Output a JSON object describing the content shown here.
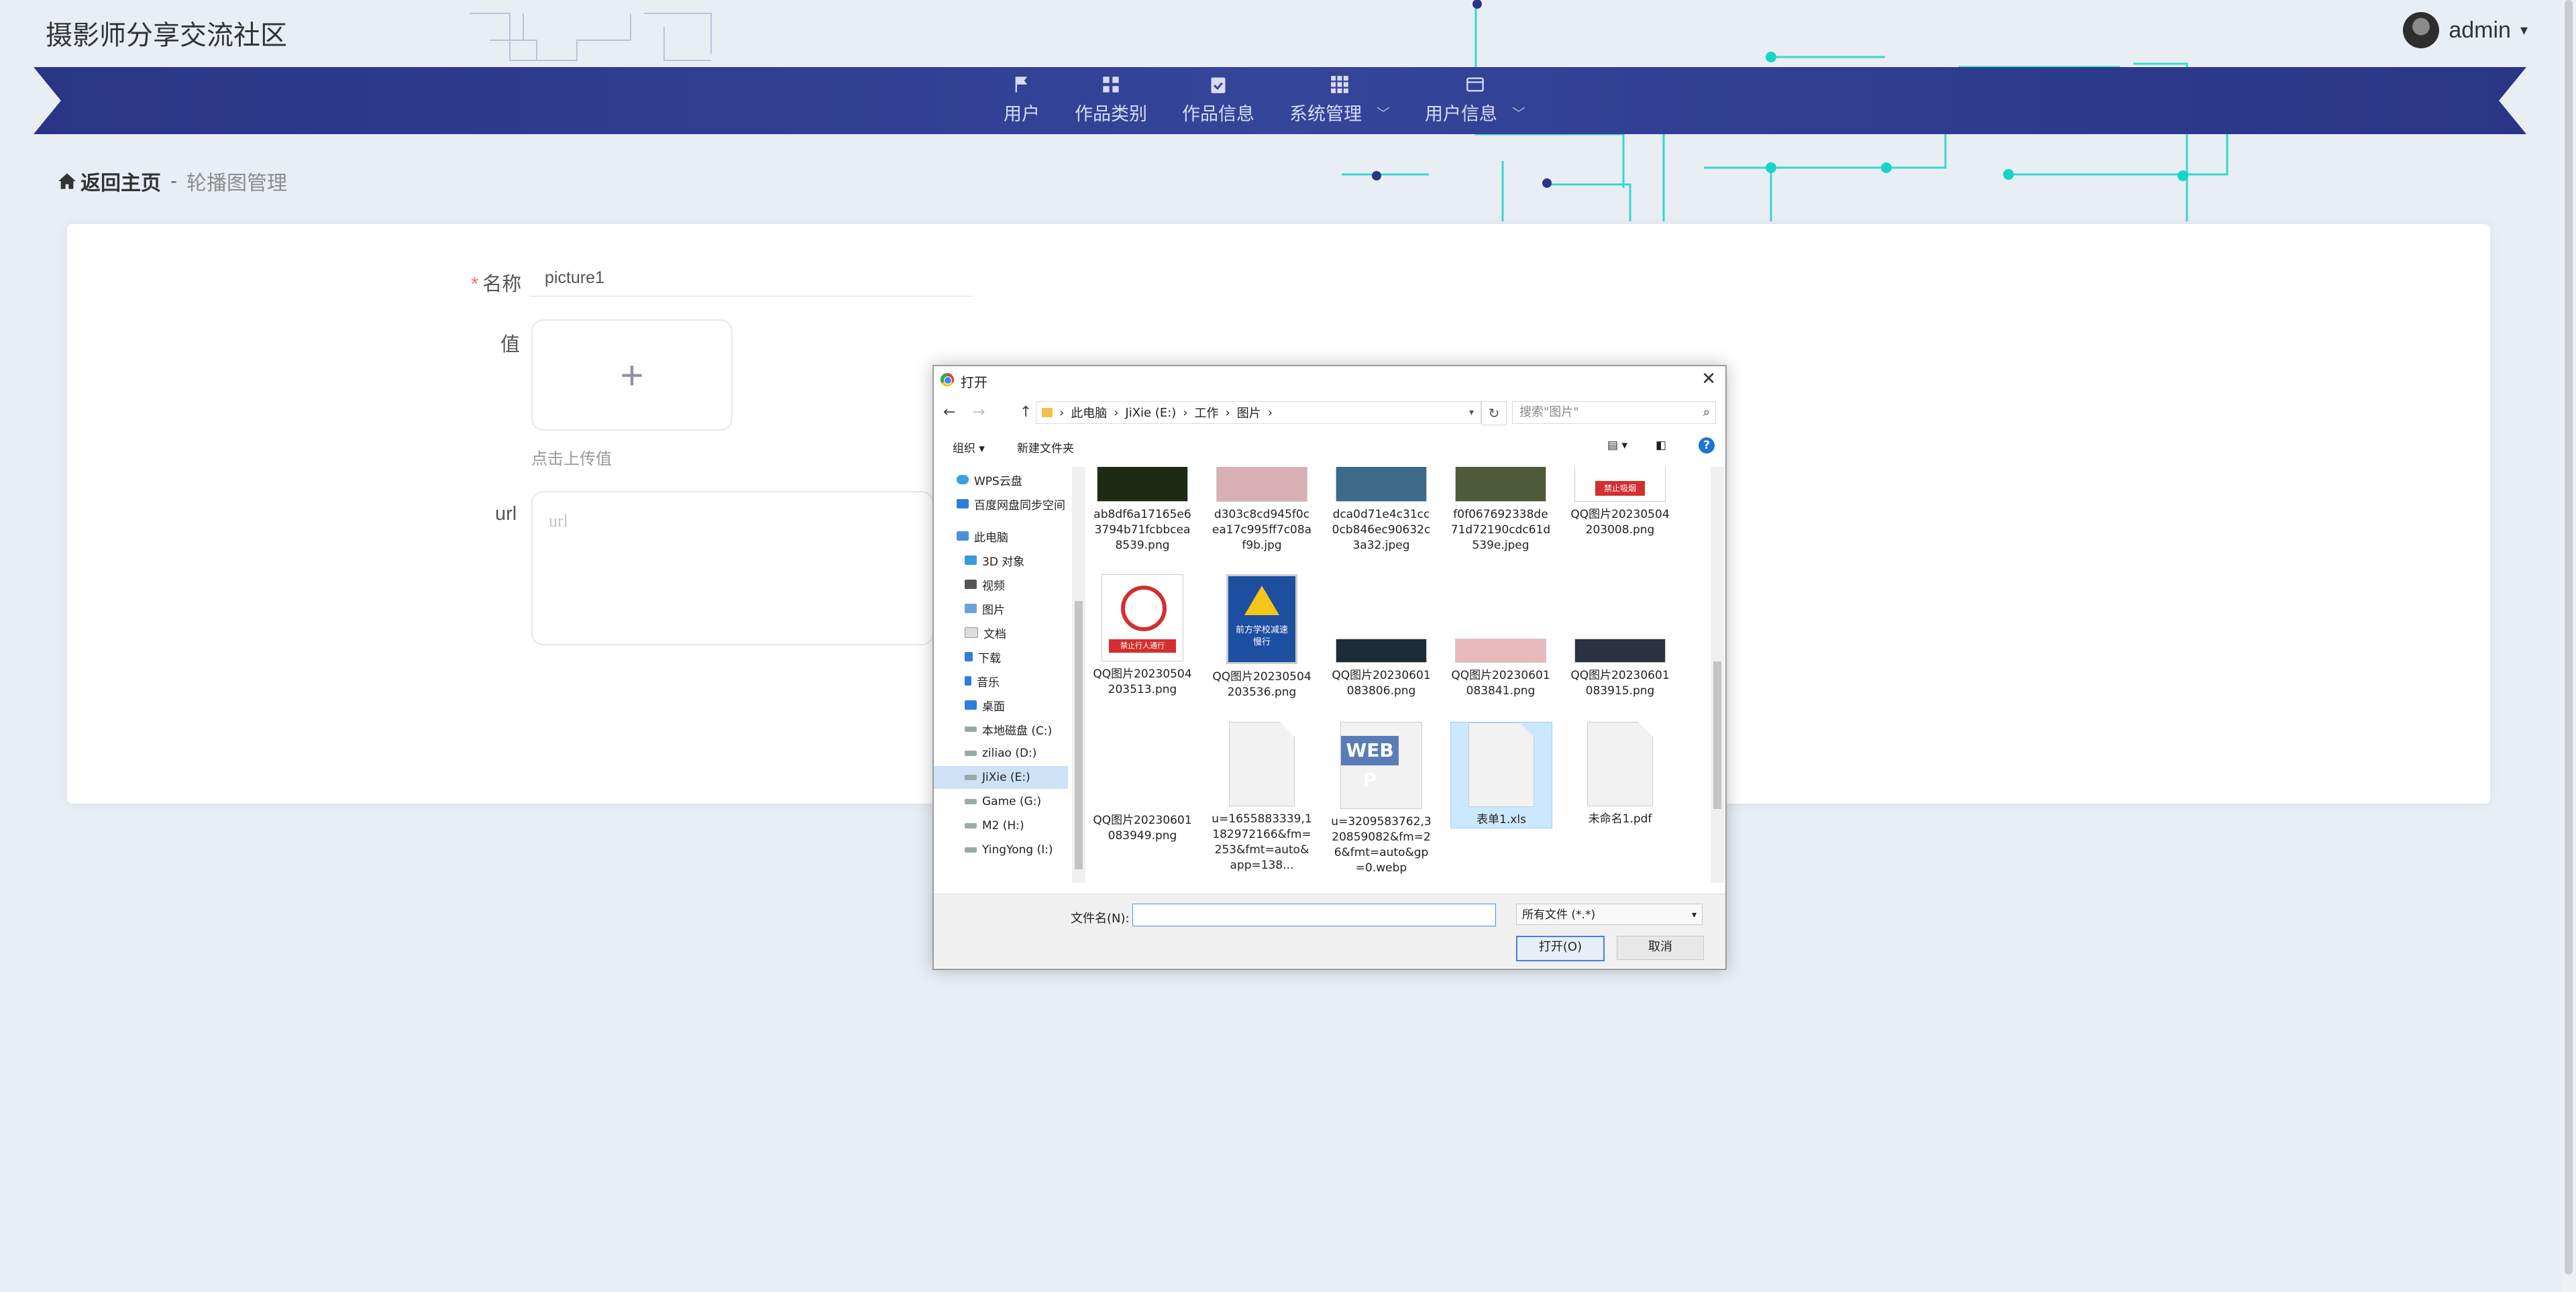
{
  "site": {
    "title": "摄影师分享交流社区"
  },
  "user": {
    "name": "admin",
    "caret": "▾"
  },
  "nav": {
    "items": [
      {
        "label": "用户",
        "icon": "flag-icon"
      },
      {
        "label": "作品类别",
        "icon": "grid-icon"
      },
      {
        "label": "作品信息",
        "icon": "clipboard-check-icon"
      },
      {
        "label": "系统管理",
        "icon": "apps-icon",
        "chevron": "﹀"
      },
      {
        "label": "用户信息",
        "icon": "card-icon",
        "chevron": "﹀"
      }
    ]
  },
  "breadcrumb": {
    "home": "返回主页",
    "separator": "-",
    "current": "轮播图管理"
  },
  "form": {
    "name_label": "名称",
    "name_value": "picture1",
    "required_mark": "*",
    "value_label": "值",
    "upload_plus": "+",
    "upload_hint": "点击上传值",
    "url_label": "url",
    "url_placeholder": "url"
  },
  "dialog": {
    "title": "打开",
    "close": "✕",
    "back": "←",
    "forward": "→",
    "up": "↑",
    "path": [
      "此电脑",
      "JiXie (E:)",
      "工作",
      "图片"
    ],
    "path_sep": "›",
    "refresh": "↻",
    "search_placeholder": "搜索\"图片\"",
    "toolbar": {
      "organize": "组织 ▾",
      "new_folder": "新建文件夹",
      "help": "?"
    },
    "nav_pane": [
      {
        "label": "WPS云盘",
        "icon": "cloud-icon"
      },
      {
        "label": "百度网盘同步空间",
        "icon": "baidu-disk-icon"
      },
      {
        "label": "此电脑",
        "icon": "pc-icon"
      },
      {
        "label": "3D 对象",
        "icon": "cube-icon"
      },
      {
        "label": "视频",
        "icon": "video-icon"
      },
      {
        "label": "图片",
        "icon": "pictures-icon"
      },
      {
        "label": "文档",
        "icon": "documents-icon"
      },
      {
        "label": "下载",
        "icon": "download-icon"
      },
      {
        "label": "音乐",
        "icon": "music-icon"
      },
      {
        "label": "桌面",
        "icon": "desktop-icon"
      },
      {
        "label": "本地磁盘 (C:)",
        "icon": "drive-icon"
      },
      {
        "label": "ziliao (D:)",
        "icon": "drive-icon"
      },
      {
        "label": "JiXie (E:)",
        "icon": "drive-icon"
      },
      {
        "label": "Game (G:)",
        "icon": "drive-icon"
      },
      {
        "label": "M2 (H:)",
        "icon": "drive-icon"
      },
      {
        "label": "YingYong (I:)",
        "icon": "drive-icon"
      }
    ],
    "files": [
      {
        "name": "ab8df6a17165e63794b71fcbbcea8539.png",
        "kind": "photo",
        "color": "#1d2a14"
      },
      {
        "name": "d303c8cd945f0cea17c995ff7c08af9b.jpg",
        "kind": "photo",
        "color": "#d9b0b6"
      },
      {
        "name": "dca0d71e4c31cc0cb846ec90632c3a32.jpeg",
        "kind": "photo",
        "color": "#3c6b8a"
      },
      {
        "name": "f0f067692338de71d72190cdc61d539e.jpeg",
        "kind": "photo",
        "color": "#4e5a3a"
      },
      {
        "name": "QQ图片20230504203008.png",
        "kind": "sign-red",
        "color": "#d32f2f",
        "sign_text": "禁止吸烟"
      },
      {
        "name": "QQ图片20230504203513.png",
        "kind": "sign-noped",
        "color": "#d32f2f",
        "sign_text": "禁止行人通行"
      },
      {
        "name": "QQ图片20230504203536.png",
        "kind": "sign-blue",
        "color": "#1c4fa0",
        "sign_text": "前方学校减速慢行"
      },
      {
        "name": "QQ图片20230601083806.png",
        "kind": "banner",
        "color": "#1c2b38"
      },
      {
        "name": "QQ图片20230601083841.png",
        "kind": "banner",
        "color": "#e7b9bd"
      },
      {
        "name": "QQ图片20230601083915.png",
        "kind": "banner",
        "color": "#2b3242"
      },
      {
        "name": "QQ图片20230601083949.png",
        "kind": "blank",
        "color": "#ffffff"
      },
      {
        "name": "u=1655883339,1182972166&fm=253&fmt=auto&app=138...",
        "kind": "doc",
        "color": "#f2f2f2"
      },
      {
        "name": "u=3209583762,320859082&fm=26&fmt=auto&gp=0.webp",
        "kind": "webp",
        "color": "#5a7db8",
        "badge": "WEBP"
      },
      {
        "name": "表单1.xls",
        "kind": "doc",
        "color": "#f2f2f2"
      },
      {
        "name": "未命名1.pdf",
        "kind": "doc",
        "color": "#f2f2f2"
      }
    ],
    "filename_label": "文件名(N):",
    "filename_value": "",
    "filetype": "所有文件 (*.*)",
    "open": "打开(O)",
    "cancel": "取消"
  },
  "colors": {
    "nav": "#2f3d8f",
    "accent": "#3d86d9",
    "circuit": "#17d4c8"
  }
}
